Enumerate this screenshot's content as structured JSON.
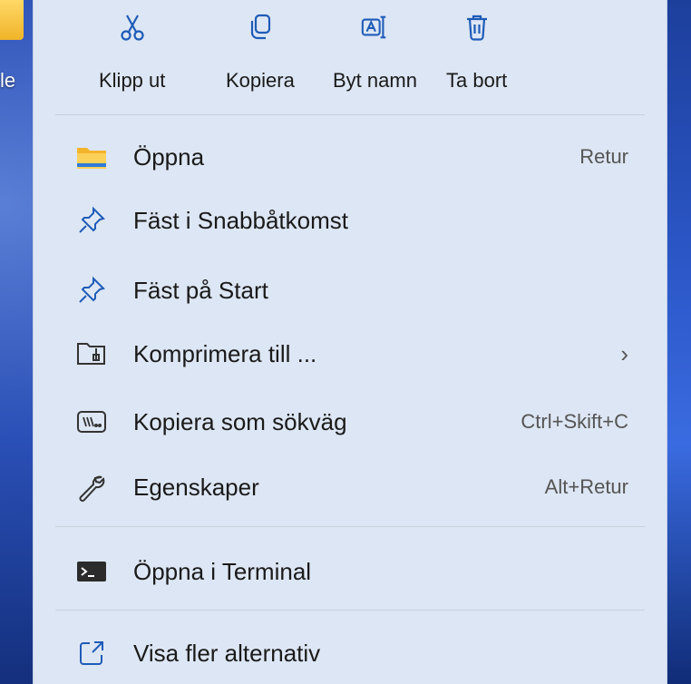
{
  "desktop": {
    "label": "le"
  },
  "toolbar": {
    "cut": {
      "label": "Klipp ut",
      "icon": "scissors-icon"
    },
    "copy": {
      "label": "Kopiera",
      "icon": "copy-icon"
    },
    "rename": {
      "label": "Byt namn",
      "icon": "rename-icon"
    },
    "delete": {
      "label": "Ta bort",
      "icon": "trash-icon"
    }
  },
  "items": [
    {
      "label": "Öppna",
      "shortcut": "Retur",
      "icon": "folder-icon"
    },
    {
      "label": "Fäst i Snabbåtkomst",
      "shortcut": "",
      "icon": "pin-icon"
    },
    {
      "label": "Fäst på Start",
      "shortcut": "",
      "icon": "pin-icon"
    },
    {
      "label": "Komprimera till ...",
      "shortcut": "›",
      "icon": "zip-folder-icon"
    },
    {
      "label": "Kopiera som sökväg",
      "shortcut": "Ctrl+Skift+C",
      "icon": "path-icon"
    },
    {
      "label": "Egenskaper",
      "shortcut": "Alt+Retur",
      "icon": "wrench-icon"
    },
    {
      "label": "Öppna i Terminal",
      "shortcut": "",
      "icon": "terminal-icon"
    },
    {
      "label": "Visa fler alternativ",
      "shortcut": "",
      "icon": "more-options-icon"
    }
  ],
  "colors": {
    "accent": "#1e5bb8",
    "menu_bg": "#dde6f4",
    "folder": "#f4b42a"
  }
}
